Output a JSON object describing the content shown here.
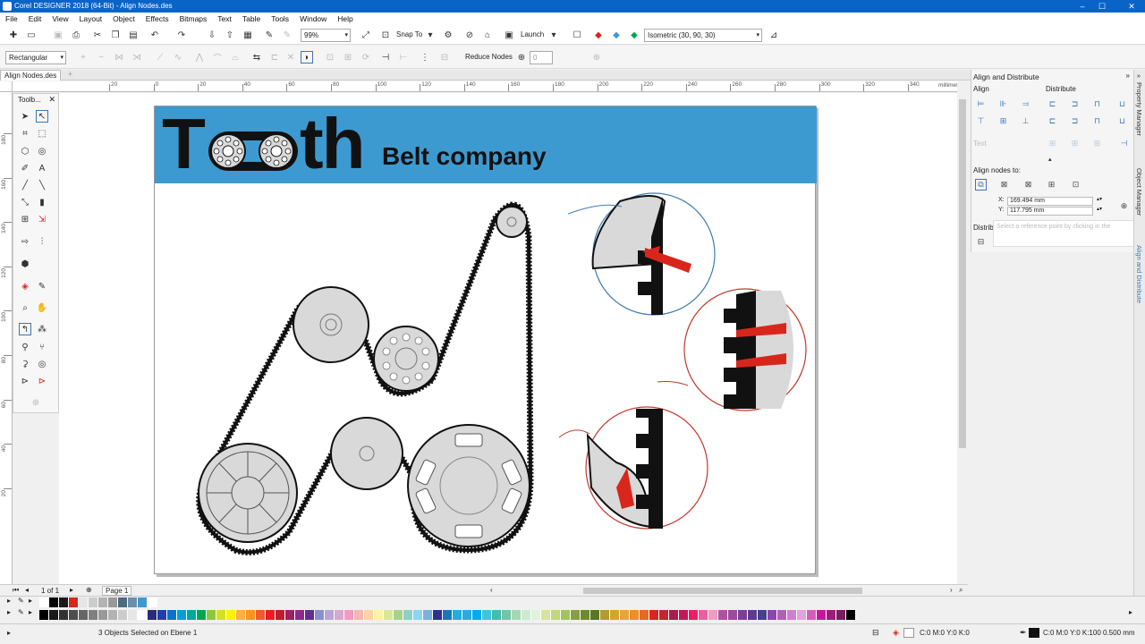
{
  "window": {
    "title": "Corel DESIGNER 2018 (64-Bit) - Align Nodes.des",
    "minimize": "–",
    "maximize": "☐",
    "close": "✕"
  },
  "menu": [
    "File",
    "Edit",
    "View",
    "Layout",
    "Object",
    "Effects",
    "Bitmaps",
    "Text",
    "Table",
    "Tools",
    "Window",
    "Help"
  ],
  "toolbar": {
    "zoom": "99%",
    "snap_label": "Snap To",
    "launch_label": "Launch",
    "view_combo": "Isometric (30, 90, 30)"
  },
  "propbar": {
    "selection_mode": "Rectangular",
    "reduce_nodes_label": "Reduce Nodes",
    "reduce_value": "0"
  },
  "doc_tab": "Align Nodes.des",
  "ruler": {
    "unit": "millimeters",
    "h_labels": [
      "20",
      "0",
      "20",
      "40",
      "60",
      "80",
      "100",
      "120",
      "140",
      "160",
      "180",
      "200",
      "220",
      "240",
      "260",
      "280",
      "300",
      "320",
      "340"
    ],
    "v_labels": [
      "180",
      "160",
      "140",
      "120",
      "100",
      "80",
      "60",
      "40",
      "20"
    ]
  },
  "toolbox": {
    "title": "Toolb..."
  },
  "artwork": {
    "logo_letter_t": "T",
    "logo_letters_th": "th",
    "subtitle": "Belt company"
  },
  "pagebar": {
    "page_count": "1 of 1",
    "page_tab": "Page 1"
  },
  "docker": {
    "title": "Align and Distribute",
    "align_label": "Align",
    "distribute_label": "Distribute",
    "text_label": "Text",
    "align_nodes_label": "Align nodes to:",
    "x_label": "X:",
    "x_value": "169.494 mm",
    "y_label": "Y:",
    "y_value": "117.795 mm",
    "distribute_nodes_label": "Distribute nodes to:",
    "tooltip": "Select a reference point by clicking in the"
  },
  "side_tabs": [
    "Property Manager",
    "Object Manager",
    "Align and Distribute"
  ],
  "status": {
    "selection": "3 Objects Selected on Ebene 1",
    "fill": "C:0 M:0 Y:0 K:0",
    "outline": "C:0 M:0 Y:0 K:100  0.500 mm"
  },
  "colors": {
    "accent": "#0a64c8",
    "banner": "#3d9ad0",
    "arrow_red": "#d9261c",
    "belt": "#111111",
    "pulley_fill": "#d9d9d9"
  },
  "palette_row1": [
    "#ffffff",
    "#000000",
    "#1a1a1a",
    "#d9261c",
    "#e6e6e6",
    "#cccccc",
    "#b3b3b3",
    "#999999",
    "#4d6b7f",
    "#6b8fa8",
    "#3d9ad0",
    "#ffffff"
  ],
  "palette_row2": [
    "#000000",
    "#1a1a1a",
    "#333333",
    "#4d4d4d",
    "#666666",
    "#808080",
    "#999999",
    "#b3b3b3",
    "#cccccc",
    "#e6e6e6",
    "#ffffff",
    "#2b2b7a",
    "#1f3fa8",
    "#0075c9",
    "#00a0d6",
    "#00a79d",
    "#00a651",
    "#8dc63f",
    "#d7df23",
    "#fff200",
    "#fbb040",
    "#f7941d",
    "#f15a29",
    "#ed1c24",
    "#be1e2d",
    "#9e1f63",
    "#92278f",
    "#662d91",
    "#8a8fd0",
    "#b7a6d4",
    "#d6a8cf",
    "#f49ac1",
    "#f7b6b0",
    "#fbd3a5",
    "#fff3a3",
    "#d8e89a",
    "#a6d28e",
    "#8fd0c4",
    "#8dd3f2",
    "#7ab0de",
    "#2e3192",
    "#1b75bc",
    "#27aae1",
    "#29abe2",
    "#00aeef",
    "#41c4d8",
    "#3fbfad",
    "#6dc8a5",
    "#a4d8b5",
    "#ccebd0",
    "#e1f3d8",
    "#d7e49d",
    "#c2d67a",
    "#a3c45c",
    "#889f3f",
    "#6f8a2e",
    "#59771f",
    "#b59a2c",
    "#d4a52a",
    "#e8a33d",
    "#f28c28",
    "#e46a1f",
    "#d9261c",
    "#c1272d",
    "#a61e4d",
    "#c2185b",
    "#e91e63",
    "#ec5f9e",
    "#f39ac0",
    "#b34fa0",
    "#9c4a9e",
    "#7b3f98",
    "#5d3a8f",
    "#473f8f",
    "#8e44ad",
    "#b35fb8",
    "#cf7fce",
    "#e0a3dd",
    "#d45dba",
    "#c2189c",
    "#a11a7d",
    "#7c1a63",
    "#000000"
  ]
}
